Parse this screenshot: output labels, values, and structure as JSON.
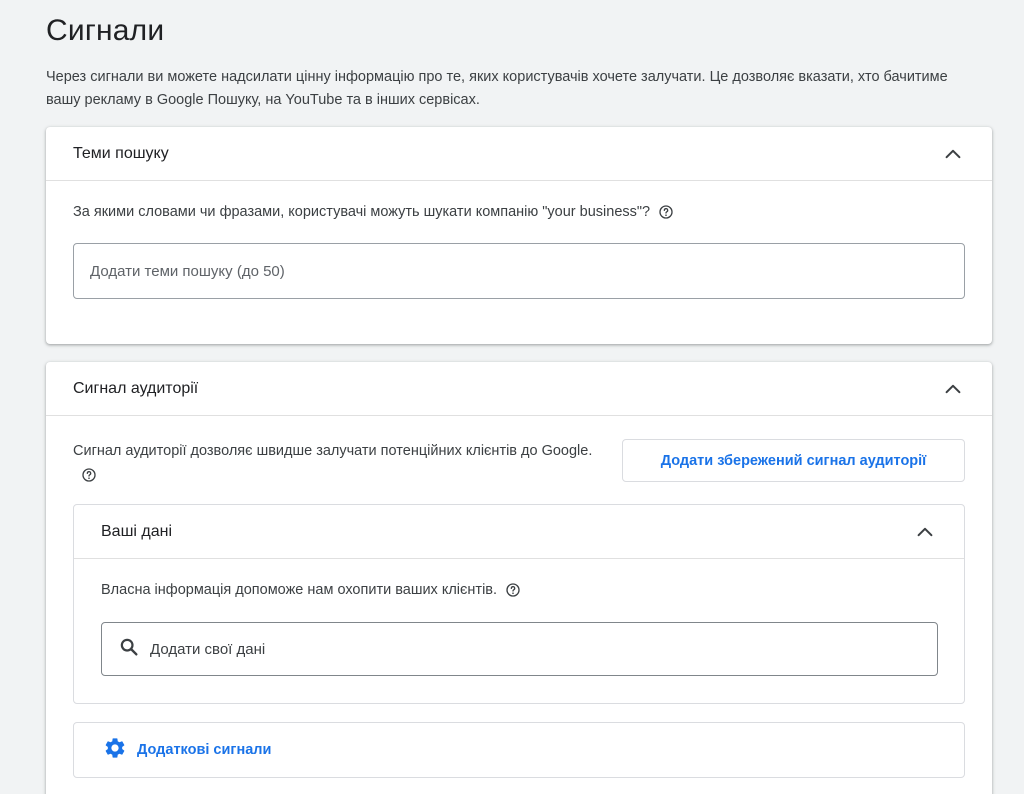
{
  "page": {
    "title": "Сигнали",
    "description": "Через сигнали ви можете надсилати цінну інформацію про те, яких користувачів хочете залучати. Це дозволяє вказати, хто бачитиме вашу рекламу в Google Пошуку, на YouTube та в інших сервісах."
  },
  "search_topics": {
    "title": "Теми пошуку",
    "question": "За якими словами чи фразами, користувачі можуть шукати компанію \"your business\"?",
    "input_placeholder": "Додати теми пошуку (до 50)",
    "input_value": ""
  },
  "audience_signal": {
    "title": "Сигнал аудиторії",
    "description": "Сигнал аудиторії дозволяє швидше залучати потенційних клієнтів до Google.",
    "saved_signal_button": "Додати збережений сигнал аудиторії",
    "your_data": {
      "title": "Ваші дані",
      "description": "Власна інформація допоможе нам охопити ваших клієнтів.",
      "search_placeholder": "Додати свої дані",
      "search_value": ""
    },
    "additional_signals": {
      "label": "Додаткові сигнали"
    }
  },
  "colors": {
    "accent": "#1a73e8",
    "background": "#f1f3f4",
    "icon": "#3c4043"
  },
  "icons": [
    "chevron-up-icon",
    "help-icon",
    "search-icon",
    "gear-icon"
  ]
}
